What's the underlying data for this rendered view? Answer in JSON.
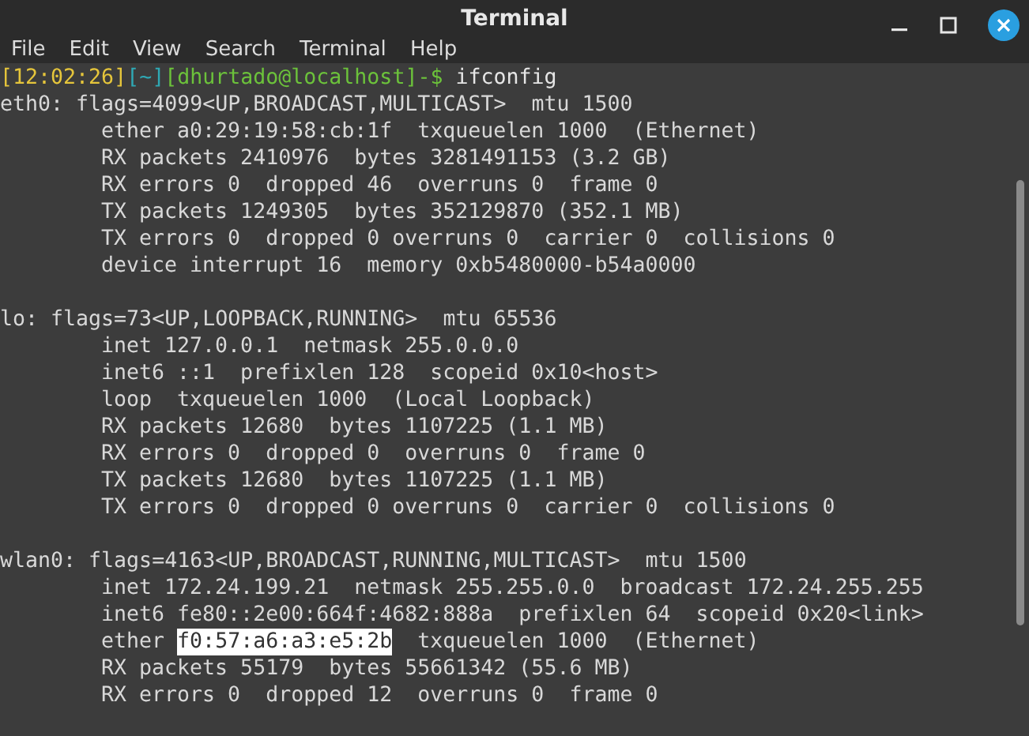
{
  "window": {
    "title": "Terminal",
    "controls": [
      {
        "kind": "minimize"
      },
      {
        "kind": "maximize"
      },
      {
        "kind": "close"
      }
    ]
  },
  "menu": [
    "File",
    "Edit",
    "View",
    "Search",
    "Terminal",
    "Help"
  ],
  "prompt": [
    {
      "kind": "time",
      "text": "[12:02:26]"
    },
    {
      "kind": "dir",
      "text": "[~]"
    },
    {
      "kind": "host",
      "text": "[dhurtado@localhost]-$"
    },
    {
      "kind": "command",
      "text": "ifconfig"
    }
  ],
  "blocks": [
    {
      "lines": [
        {
          "indented": false,
          "segments": [
            {
              "text": "eth0: flags=4099<UP,BROADCAST,MULTICAST>  mtu 1500",
              "selected": false
            }
          ]
        },
        {
          "indented": true,
          "segments": [
            {
              "text": "ether a0:29:19:58:cb:1f  txqueuelen 1000  (Ethernet)",
              "selected": false
            }
          ]
        },
        {
          "indented": true,
          "segments": [
            {
              "text": "RX packets 2410976  bytes 3281491153 (3.2 GB)",
              "selected": false
            }
          ]
        },
        {
          "indented": true,
          "segments": [
            {
              "text": "RX errors 0  dropped 46  overruns 0  frame 0",
              "selected": false
            }
          ]
        },
        {
          "indented": true,
          "segments": [
            {
              "text": "TX packets 1249305  bytes 352129870 (352.1 MB)",
              "selected": false
            }
          ]
        },
        {
          "indented": true,
          "segments": [
            {
              "text": "TX errors 0  dropped 0 overruns 0  carrier 0  collisions 0",
              "selected": false
            }
          ]
        },
        {
          "indented": true,
          "segments": [
            {
              "text": "device interrupt 16  memory 0xb5480000-b54a0000",
              "selected": false
            }
          ]
        }
      ]
    },
    {
      "lines": [
        {
          "indented": false,
          "segments": [
            {
              "text": "lo: flags=73<UP,LOOPBACK,RUNNING>  mtu 65536",
              "selected": false
            }
          ]
        },
        {
          "indented": true,
          "segments": [
            {
              "text": "inet 127.0.0.1  netmask 255.0.0.0",
              "selected": false
            }
          ]
        },
        {
          "indented": true,
          "segments": [
            {
              "text": "inet6 ::1  prefixlen 128  scopeid 0x10<host>",
              "selected": false
            }
          ]
        },
        {
          "indented": true,
          "segments": [
            {
              "text": "loop  txqueuelen 1000  (Local Loopback)",
              "selected": false
            }
          ]
        },
        {
          "indented": true,
          "segments": [
            {
              "text": "RX packets 12680  bytes 1107225 (1.1 MB)",
              "selected": false
            }
          ]
        },
        {
          "indented": true,
          "segments": [
            {
              "text": "RX errors 0  dropped 0  overruns 0  frame 0",
              "selected": false
            }
          ]
        },
        {
          "indented": true,
          "segments": [
            {
              "text": "TX packets 12680  bytes 1107225 (1.1 MB)",
              "selected": false
            }
          ]
        },
        {
          "indented": true,
          "segments": [
            {
              "text": "TX errors 0  dropped 0 overruns 0  carrier 0  collisions 0",
              "selected": false
            }
          ]
        }
      ]
    },
    {
      "lines": [
        {
          "indented": false,
          "segments": [
            {
              "text": "wlan0: flags=4163<UP,BROADCAST,RUNNING,MULTICAST>  mtu 1500",
              "selected": false
            }
          ]
        },
        {
          "indented": true,
          "segments": [
            {
              "text": "inet 172.24.199.21  netmask 255.255.0.0  broadcast 172.24.255.255",
              "selected": false
            }
          ]
        },
        {
          "indented": true,
          "segments": [
            {
              "text": "inet6 fe80::2e00:664f:4682:888a  prefixlen 64  scopeid 0x20<link>",
              "selected": false
            }
          ]
        },
        {
          "indented": true,
          "segments": [
            {
              "text": "ether ",
              "selected": false
            },
            {
              "text": "f0:57:a6:a3:e5:2b",
              "selected": true
            },
            {
              "text": "  txqueuelen 1000  (Ethernet)",
              "selected": false
            }
          ]
        },
        {
          "indented": true,
          "segments": [
            {
              "text": "RX packets 55179  bytes 55661342 (55.6 MB)",
              "selected": false
            }
          ]
        },
        {
          "indented": true,
          "segments": [
            {
              "text": "RX errors 0  dropped 12  overruns 0  frame 0",
              "selected": false
            }
          ]
        }
      ]
    }
  ]
}
